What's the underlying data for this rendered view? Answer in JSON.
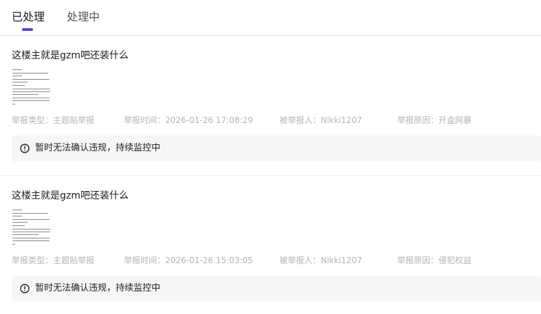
{
  "tabs": [
    {
      "label": "已处理",
      "active": true
    },
    {
      "label": "处理中",
      "active": false
    }
  ],
  "accent_color": "#5b3fe0",
  "reports": [
    {
      "post_title": "这楼主就是gzm吧还装什么",
      "thumbnail_icon": "post-screenshot-thumbnail",
      "type": "举报类型：主题贴举报",
      "time": "举报时间：2026-01-26 17:08:29",
      "reported_user": "被举报人：Nikki1207",
      "reason": "举报原因：开盒网暴",
      "status_icon": "exclamation-circle-icon",
      "status": "暂时无法确认违规，持续监控中"
    },
    {
      "post_title": "这楼主就是gzm吧还装什么",
      "thumbnail_icon": "post-screenshot-thumbnail",
      "type": "举报类型：主题贴举报",
      "time": "举报时间：2026-01-26 15:03:05",
      "reported_user": "被举报人：Nikki1207",
      "reason": "举报原因：侵犯权益",
      "status_icon": "exclamation-circle-icon",
      "status": "暂时无法确认违规，持续监控中"
    }
  ]
}
